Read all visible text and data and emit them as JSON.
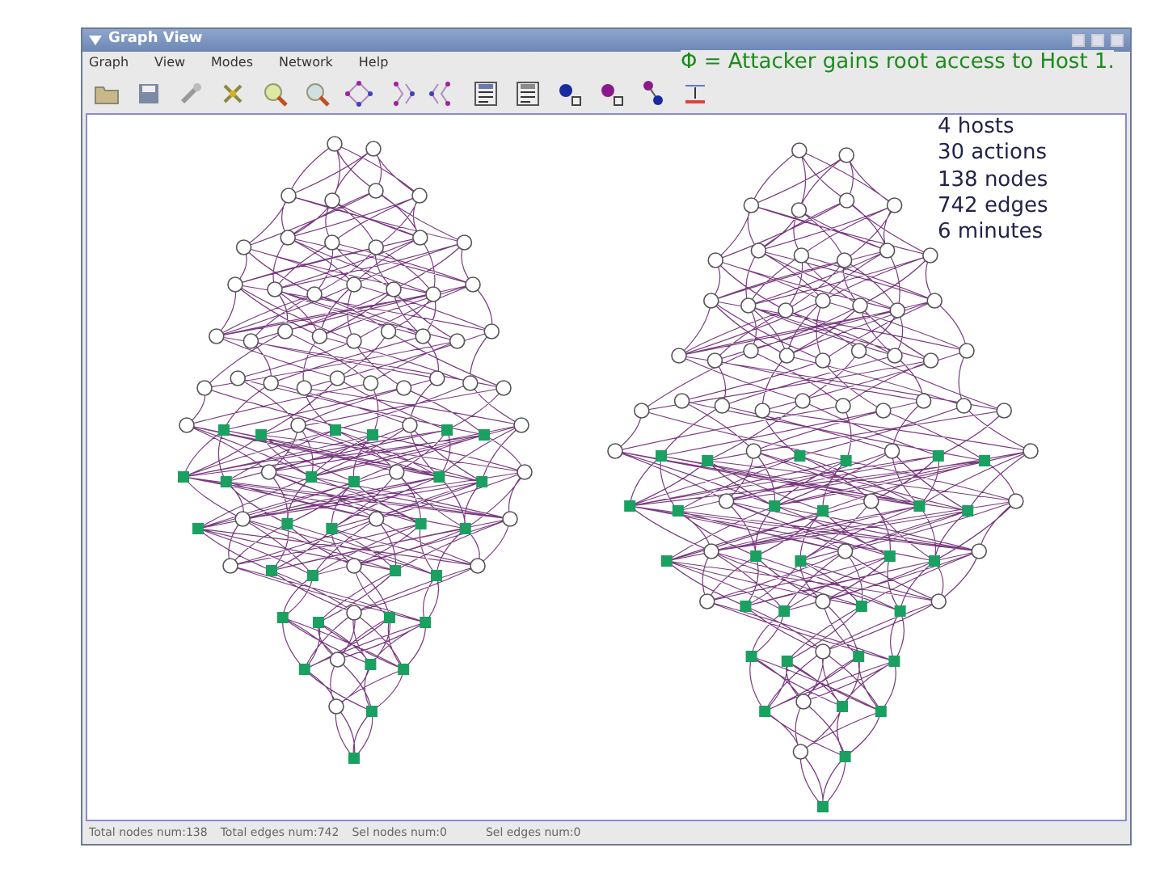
{
  "window": {
    "title": "Graph View"
  },
  "menu": [
    {
      "label": "Graph"
    },
    {
      "label": "View"
    },
    {
      "label": "Modes"
    },
    {
      "label": "Network"
    },
    {
      "label": "Help"
    }
  ],
  "annotation": "Φ = Attacker gains root access to Host 1.",
  "stats": [
    "4 hosts",
    "30 actions",
    "138 nodes",
    "742 edges",
    "6 minutes"
  ],
  "status_bar": [
    "Total nodes num:138",
    "Total edges num:742",
    "Sel nodes num:0",
    "Sel edges num:0"
  ]
}
